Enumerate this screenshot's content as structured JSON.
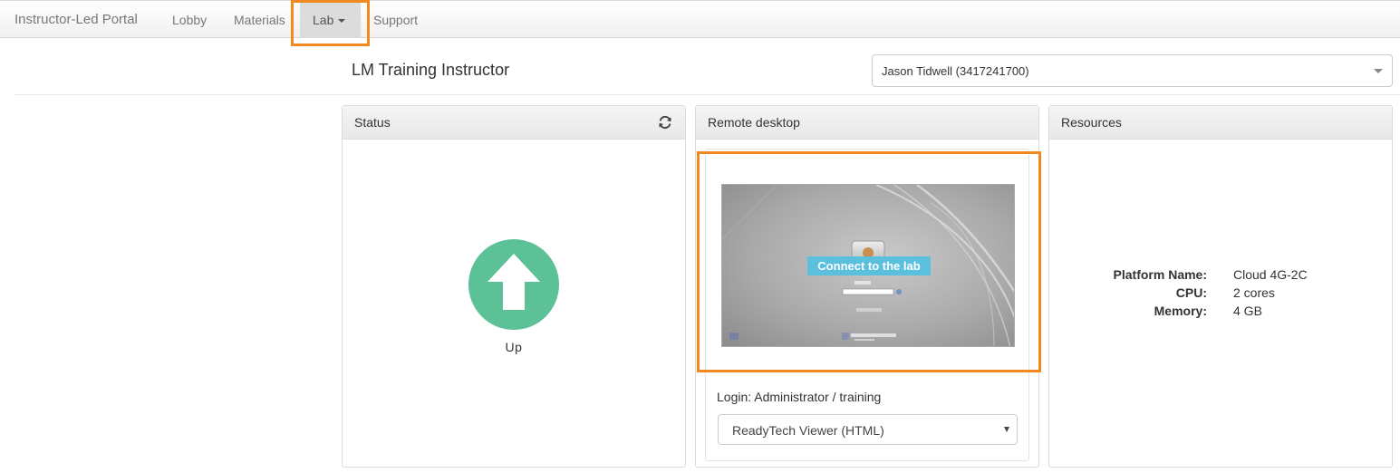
{
  "navbar": {
    "brand": "Instructor-Led Portal",
    "items": [
      {
        "label": "Lobby"
      },
      {
        "label": "Materials"
      },
      {
        "label": "Lab"
      },
      {
        "label": "Support"
      }
    ]
  },
  "header": {
    "title": "LM Training Instructor",
    "user_select_value": "Jason Tidwell (3417241700)"
  },
  "status_panel": {
    "title": "Status",
    "status": "Up",
    "status_color": "#5cc196"
  },
  "remote_panel": {
    "title": "Remote desktop",
    "connect_label": "Connect to the lab",
    "login_text": "Login: Administrator / training",
    "viewer_value": "ReadyTech Viewer (HTML)"
  },
  "resources_panel": {
    "title": "Resources",
    "rows": [
      {
        "label": "Platform Name:",
        "value": "Cloud 4G-2C"
      },
      {
        "label": "CPU:",
        "value": "2 cores"
      },
      {
        "label": "Memory:",
        "value": "4 GB"
      }
    ]
  },
  "colors": {
    "highlight": "#f08a1e",
    "connect_button": "#5bc0de"
  }
}
